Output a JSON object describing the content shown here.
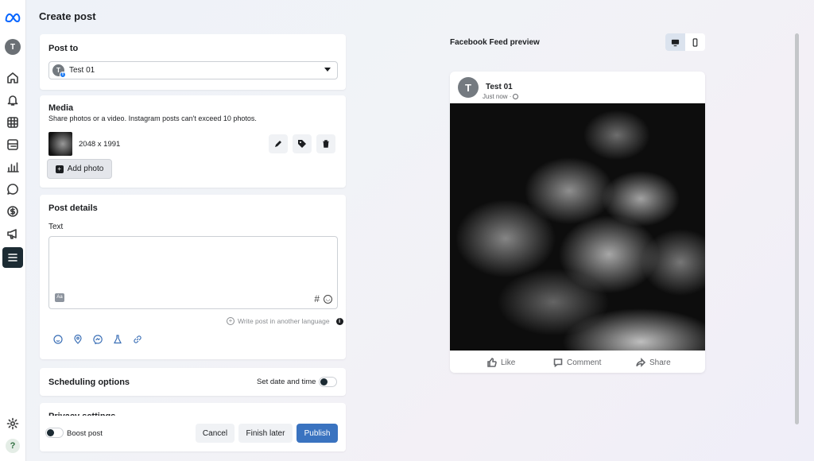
{
  "page": {
    "title": "Create post"
  },
  "rail": {
    "avatar_initial": "T"
  },
  "post_to": {
    "heading": "Post to",
    "account": "Test 01",
    "avatar_initial": "T"
  },
  "media": {
    "heading": "Media",
    "description": "Share photos or a video. Instagram posts can't exceed 10 photos.",
    "file_dims": "2048 x 1991",
    "add_photo": "Add photo"
  },
  "post_details": {
    "heading": "Post details",
    "text_label": "Text",
    "hashtag": "#",
    "translate_link": "Write post in another language"
  },
  "scheduling": {
    "heading": "Scheduling options",
    "set_date_label": "Set date and time"
  },
  "privacy": {
    "heading": "Privacy settings"
  },
  "footer": {
    "boost_label": "Boost post",
    "cancel": "Cancel",
    "finish_later": "Finish later",
    "publish": "Publish"
  },
  "preview": {
    "heading": "Facebook Feed preview",
    "author": "Test 01",
    "avatar_initial": "T",
    "timestamp": "Just now · ",
    "like": "Like",
    "comment": "Comment",
    "share": "Share"
  },
  "colors": {
    "primary": "#3a73c0",
    "page_bg": "#eef2f8",
    "dark": "#1c2b33"
  }
}
